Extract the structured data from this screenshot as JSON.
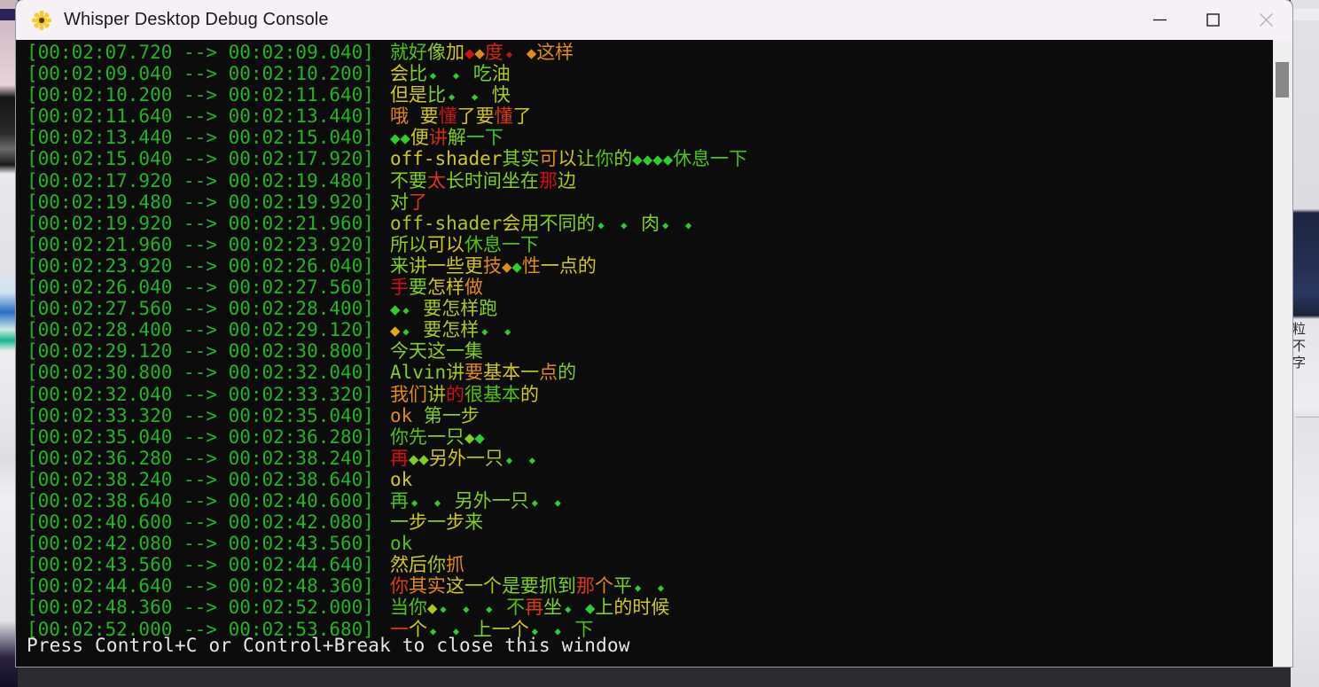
{
  "window": {
    "title": "Whisper Desktop Debug Console",
    "icon": "sunflower-icon",
    "controls": {
      "minimize": "minimize-icon",
      "maximize": "maximize-icon",
      "close": "close-icon"
    }
  },
  "colors": {
    "titlebar_bg": "#f6f1f6",
    "console_bg": "#0c0c0c",
    "timestamp_green": "#22b522",
    "status_text": "#e6e6e6",
    "scrollbar_track": "#efeff0",
    "scrollbar_thumb": "#878787",
    "conf_high": "#2ecc2e",
    "conf_good": "#7fcf1f",
    "conf_mid": "#cfc81a",
    "conf_low": "#e08a12",
    "conf_vlow": "#d83a12",
    "conf_worst": "#d01010"
  },
  "console": {
    "status": "Press Control+C or Control+Break to close this window",
    "lines": [
      {
        "start": "00:02:07.720",
        "end": "00:02:09.040",
        "segments": [
          {
            "t": "就好",
            "c": "#4fc20f"
          },
          {
            "t": "像",
            "c": "#8ecb12"
          },
          {
            "t": "加",
            "c": "#cfc81a"
          },
          {
            "t": "◆",
            "c": "#d01010",
            "glyph": "big"
          },
          {
            "t": "◆",
            "c": "#e08a12",
            "glyph": "big"
          },
          {
            "t": "度",
            "c": "#d02a0f"
          },
          {
            "t": "◆",
            "c": "#c01a0f",
            "glyph": "small"
          },
          {
            "t": " ",
            "c": "#000000"
          },
          {
            "t": "◆",
            "c": "#e08a12",
            "glyph": "big"
          },
          {
            "t": "这样",
            "c": "#e08a12"
          }
        ]
      },
      {
        "start": "00:02:09.040",
        "end": "00:02:10.200",
        "segments": [
          {
            "t": "会",
            "c": "#cfc81a"
          },
          {
            "t": "比",
            "c": "#7fcf1f"
          },
          {
            "t": "◆",
            "c": "#2ecc2e",
            "glyph": "small"
          },
          {
            "t": " ",
            "c": "#000000"
          },
          {
            "t": "◆",
            "c": "#2ecc2e",
            "glyph": "small"
          },
          {
            "t": " ",
            "c": "#000000"
          },
          {
            "t": "吃",
            "c": "#6fcc17"
          },
          {
            "t": "油",
            "c": "#a9c915"
          }
        ]
      },
      {
        "start": "00:02:10.200",
        "end": "00:02:11.640",
        "segments": [
          {
            "t": "但是",
            "c": "#cfc81a"
          },
          {
            "t": "比",
            "c": "#7fcf1f"
          },
          {
            "t": "◆",
            "c": "#2ecc2e",
            "glyph": "small"
          },
          {
            "t": " ",
            "c": "#000000"
          },
          {
            "t": "◆",
            "c": "#2ecc2e",
            "glyph": "small"
          },
          {
            "t": " ",
            "c": "#000000"
          },
          {
            "t": "快",
            "c": "#a9c915"
          }
        ]
      },
      {
        "start": "00:02:11.640",
        "end": "00:02:13.440",
        "segments": [
          {
            "t": "哦",
            "c": "#e08a12"
          },
          {
            "t": " ",
            "c": "#000000"
          },
          {
            "t": "要",
            "c": "#cfc81a"
          },
          {
            "t": "懂",
            "c": "#c01a0f"
          },
          {
            "t": "了",
            "c": "#cfc81a"
          },
          {
            "t": "要",
            "c": "#cfc81a"
          },
          {
            "t": "懂",
            "c": "#d83a12"
          },
          {
            "t": "了",
            "c": "#cfc81a"
          }
        ]
      },
      {
        "start": "00:02:13.440",
        "end": "00:02:15.040",
        "segments": [
          {
            "t": "◆",
            "c": "#2ecc2e",
            "glyph": "big"
          },
          {
            "t": "◆",
            "c": "#2ecc2e",
            "glyph": "big"
          },
          {
            "t": "便",
            "c": "#cfc81a"
          },
          {
            "t": "讲",
            "c": "#d02a0f"
          },
          {
            "t": "解",
            "c": "#7fcf1f"
          },
          {
            "t": "一下",
            "c": "#2ecc2e"
          }
        ]
      },
      {
        "start": "00:02:15.040",
        "end": "00:02:17.920",
        "segments": [
          {
            "t": "off-shader",
            "c": "#cfc81a"
          },
          {
            "t": "其实",
            "c": "#7fcf1f"
          },
          {
            "t": "可",
            "c": "#e08a12"
          },
          {
            "t": "以",
            "c": "#cfc81a"
          },
          {
            "t": "让",
            "c": "#8ecb12"
          },
          {
            "t": "你",
            "c": "#4fc20f"
          },
          {
            "t": "的",
            "c": "#7fcf1f"
          },
          {
            "t": "◆",
            "c": "#2ecc2e",
            "glyph": "big"
          },
          {
            "t": "◆",
            "c": "#2ecc2e",
            "glyph": "big"
          },
          {
            "t": "◆",
            "c": "#2ecc2e",
            "glyph": "big"
          },
          {
            "t": "◆",
            "c": "#2ecc2e",
            "glyph": "big"
          },
          {
            "t": "休息一下",
            "c": "#4fc20f"
          }
        ]
      },
      {
        "start": "00:02:17.920",
        "end": "00:02:19.480",
        "segments": [
          {
            "t": "不要",
            "c": "#7fcf1f"
          },
          {
            "t": "太",
            "c": "#d83a12"
          },
          {
            "t": "长时间坐在",
            "c": "#7fcf1f"
          },
          {
            "t": "那",
            "c": "#d01010"
          },
          {
            "t": "边",
            "c": "#a9c915"
          }
        ]
      },
      {
        "start": "00:02:19.480",
        "end": "00:02:19.920",
        "segments": [
          {
            "t": "对",
            "c": "#7fcf1f"
          },
          {
            "t": "了",
            "c": "#d83a12"
          }
        ]
      },
      {
        "start": "00:02:19.920",
        "end": "00:02:21.960",
        "segments": [
          {
            "t": "off-shader",
            "c": "#a9c915"
          },
          {
            "t": "会",
            "c": "#cfc81a"
          },
          {
            "t": "用",
            "c": "#8ecb12"
          },
          {
            "t": "不同的",
            "c": "#7fcf1f"
          },
          {
            "t": "◆",
            "c": "#2ecc2e",
            "glyph": "small"
          },
          {
            "t": " ",
            "c": "#000000"
          },
          {
            "t": "◆",
            "c": "#2ecc2e",
            "glyph": "small"
          },
          {
            "t": " ",
            "c": "#000000"
          },
          {
            "t": "肉",
            "c": "#7fcf1f"
          },
          {
            "t": "◆",
            "c": "#2ecc2e",
            "glyph": "small"
          },
          {
            "t": " ",
            "c": "#000000"
          },
          {
            "t": "◆",
            "c": "#2ecc2e",
            "glyph": "small"
          }
        ]
      },
      {
        "start": "00:02:21.960",
        "end": "00:02:23.920",
        "segments": [
          {
            "t": "所以",
            "c": "#8ecb12"
          },
          {
            "t": "可以",
            "c": "#cfc81a"
          },
          {
            "t": "休息一下",
            "c": "#4fc20f"
          }
        ]
      },
      {
        "start": "00:02:23.920",
        "end": "00:02:26.040",
        "segments": [
          {
            "t": "来",
            "c": "#7fcf1f"
          },
          {
            "t": "讲",
            "c": "#a9c915"
          },
          {
            "t": "一些",
            "c": "#cfc81a"
          },
          {
            "t": "更",
            "c": "#cfc81a"
          },
          {
            "t": "技",
            "c": "#e08a12"
          },
          {
            "t": "◆",
            "c": "#e08a12",
            "glyph": "big"
          },
          {
            "t": "◆",
            "c": "#2ecc2e",
            "glyph": "big"
          },
          {
            "t": "性",
            "c": "#e08a12"
          },
          {
            "t": "一点的",
            "c": "#cfc81a"
          }
        ]
      },
      {
        "start": "00:02:26.040",
        "end": "00:02:27.560",
        "segments": [
          {
            "t": "手",
            "c": "#d01010"
          },
          {
            "t": "要",
            "c": "#7fcf1f"
          },
          {
            "t": "怎样",
            "c": "#cfc81a"
          },
          {
            "t": "做",
            "c": "#e08a12"
          }
        ]
      },
      {
        "start": "00:02:27.560",
        "end": "00:02:28.400",
        "segments": [
          {
            "t": "◆",
            "c": "#2ecc2e",
            "glyph": "big"
          },
          {
            "t": "◆",
            "c": "#2ecc2e",
            "glyph": "small"
          },
          {
            "t": " ",
            "c": "#000000"
          },
          {
            "t": "要怎样",
            "c": "#a9c915"
          },
          {
            "t": "跑",
            "c": "#7fcf1f"
          }
        ]
      },
      {
        "start": "00:02:28.400",
        "end": "00:02:29.120",
        "segments": [
          {
            "t": "◆",
            "c": "#e0a812",
            "glyph": "big"
          },
          {
            "t": "◆",
            "c": "#2ecc2e",
            "glyph": "small"
          },
          {
            "t": " ",
            "c": "#000000"
          },
          {
            "t": "要怎样",
            "c": "#a9c915"
          },
          {
            "t": "◆",
            "c": "#2ecc2e",
            "glyph": "small"
          },
          {
            "t": " ",
            "c": "#000000"
          },
          {
            "t": "◆",
            "c": "#2ecc2e",
            "glyph": "small"
          }
        ]
      },
      {
        "start": "00:02:29.120",
        "end": "00:02:30.800",
        "segments": [
          {
            "t": "今天",
            "c": "#7fcf1f"
          },
          {
            "t": "这",
            "c": "#8ecb12"
          },
          {
            "t": "一集",
            "c": "#7fcf1f"
          }
        ]
      },
      {
        "start": "00:02:30.800",
        "end": "00:02:32.040",
        "segments": [
          {
            "t": "Alvin",
            "c": "#7fcf1f"
          },
          {
            "t": "讲",
            "c": "#a9c915"
          },
          {
            "t": "要",
            "c": "#e08a12"
          },
          {
            "t": "基本",
            "c": "#cfc81a"
          },
          {
            "t": "一",
            "c": "#a9c915"
          },
          {
            "t": "点",
            "c": "#e08a12"
          },
          {
            "t": "的",
            "c": "#7fcf1f"
          }
        ]
      },
      {
        "start": "00:02:32.040",
        "end": "00:02:33.320",
        "segments": [
          {
            "t": "我们",
            "c": "#e08a12"
          },
          {
            "t": "讲",
            "c": "#a9c915"
          },
          {
            "t": "的",
            "c": "#d01010"
          },
          {
            "t": "很",
            "c": "#4fc20f"
          },
          {
            "t": "基本",
            "c": "#4fc20f"
          },
          {
            "t": "的",
            "c": "#cfc81a"
          }
        ]
      },
      {
        "start": "00:02:33.320",
        "end": "00:02:35.040",
        "segments": [
          {
            "t": "ok",
            "c": "#e08a12"
          },
          {
            "t": " ",
            "c": "#000000"
          },
          {
            "t": "第一",
            "c": "#7fcf1f"
          },
          {
            "t": "步",
            "c": "#a9c915"
          }
        ]
      },
      {
        "start": "00:02:35.040",
        "end": "00:02:36.280",
        "segments": [
          {
            "t": "你先",
            "c": "#4fc20f"
          },
          {
            "t": "一只",
            "c": "#7fcf1f"
          },
          {
            "t": "◆",
            "c": "#7fcf1f",
            "glyph": "big"
          },
          {
            "t": "◆",
            "c": "#2ecc2e",
            "glyph": "big"
          }
        ]
      },
      {
        "start": "00:02:36.280",
        "end": "00:02:38.240",
        "segments": [
          {
            "t": "再",
            "c": "#d01010"
          },
          {
            "t": "◆",
            "c": "#7fcf1f",
            "glyph": "big"
          },
          {
            "t": "◆",
            "c": "#7fcf1f",
            "glyph": "big"
          },
          {
            "t": "另外",
            "c": "#cfc81a"
          },
          {
            "t": "一只",
            "c": "#a9c915"
          },
          {
            "t": "◆",
            "c": "#2ecc2e",
            "glyph": "small"
          },
          {
            "t": " ",
            "c": "#000000"
          },
          {
            "t": "◆",
            "c": "#2ecc2e",
            "glyph": "small"
          }
        ]
      },
      {
        "start": "00:02:38.240",
        "end": "00:02:38.640",
        "segments": [
          {
            "t": "ok",
            "c": "#cfc81a"
          }
        ]
      },
      {
        "start": "00:02:38.640",
        "end": "00:02:40.600",
        "segments": [
          {
            "t": "再",
            "c": "#4fc20f"
          },
          {
            "t": "◆",
            "c": "#2ecc2e",
            "glyph": "small"
          },
          {
            "t": " ",
            "c": "#000000"
          },
          {
            "t": "◆",
            "c": "#2ecc2e",
            "glyph": "small"
          },
          {
            "t": " ",
            "c": "#000000"
          },
          {
            "t": "另外一只",
            "c": "#7fcf1f"
          },
          {
            "t": "◆",
            "c": "#2ecc2e",
            "glyph": "small"
          },
          {
            "t": " ",
            "c": "#000000"
          },
          {
            "t": "◆",
            "c": "#2ecc2e",
            "glyph": "small"
          }
        ]
      },
      {
        "start": "00:02:40.600",
        "end": "00:02:42.080",
        "segments": [
          {
            "t": "一",
            "c": "#7fcf1f"
          },
          {
            "t": "步",
            "c": "#cfc81a"
          },
          {
            "t": "一",
            "c": "#7fcf1f"
          },
          {
            "t": "步",
            "c": "#cfc81a"
          },
          {
            "t": "来",
            "c": "#7fcf1f"
          }
        ]
      },
      {
        "start": "00:02:42.080",
        "end": "00:02:43.560",
        "segments": [
          {
            "t": "ok",
            "c": "#4fc20f"
          }
        ]
      },
      {
        "start": "00:02:43.560",
        "end": "00:02:44.640",
        "segments": [
          {
            "t": "然后",
            "c": "#cfc81a"
          },
          {
            "t": "你",
            "c": "#a9c915"
          },
          {
            "t": "抓",
            "c": "#e08a12"
          }
        ]
      },
      {
        "start": "00:02:44.640",
        "end": "00:02:48.360",
        "segments": [
          {
            "t": "你",
            "c": "#d83a12"
          },
          {
            "t": "其实",
            "c": "#e08a12"
          },
          {
            "t": "这",
            "c": "#cfc81a"
          },
          {
            "t": "一个",
            "c": "#a9c915"
          },
          {
            "t": "是要",
            "c": "#7fcf1f"
          },
          {
            "t": "抓到",
            "c": "#7fcf1f"
          },
          {
            "t": "那",
            "c": "#d83a12"
          },
          {
            "t": "个",
            "c": "#e08a12"
          },
          {
            "t": "平",
            "c": "#7fcf1f"
          },
          {
            "t": "◆",
            "c": "#2ecc2e",
            "glyph": "small"
          },
          {
            "t": " ",
            "c": "#000000"
          },
          {
            "t": "◆",
            "c": "#2ecc2e",
            "glyph": "small"
          }
        ]
      },
      {
        "start": "00:02:48.360",
        "end": "00:02:52.000",
        "segments": [
          {
            "t": "当你",
            "c": "#4fc20f"
          },
          {
            "t": "◆",
            "c": "#a9c915",
            "glyph": "big"
          },
          {
            "t": "◆",
            "c": "#2ecc2e",
            "glyph": "small"
          },
          {
            "t": " ",
            "c": "#000000"
          },
          {
            "t": "◆",
            "c": "#2ecc2e",
            "glyph": "small"
          },
          {
            "t": " ",
            "c": "#000000"
          },
          {
            "t": "◆",
            "c": "#2ecc2e",
            "glyph": "small"
          },
          {
            "t": " ",
            "c": "#000000"
          },
          {
            "t": "不",
            "c": "#4fc20f"
          },
          {
            "t": "再",
            "c": "#d83a12"
          },
          {
            "t": "坐",
            "c": "#7fcf1f"
          },
          {
            "t": "◆",
            "c": "#2ecc2e",
            "glyph": "small"
          },
          {
            "t": " ",
            "c": "#000000"
          },
          {
            "t": "◆",
            "c": "#2ecc2e",
            "glyph": "big"
          },
          {
            "t": "上",
            "c": "#7fcf1f"
          },
          {
            "t": "的时候",
            "c": "#cfc81a"
          }
        ]
      },
      {
        "start": "00:02:52.000",
        "end": "00:02:53.680",
        "segments": [
          {
            "t": "一",
            "c": "#d83a12"
          },
          {
            "t": "个",
            "c": "#cfc81a"
          },
          {
            "t": "◆",
            "c": "#2ecc2e",
            "glyph": "small"
          },
          {
            "t": " ",
            "c": "#000000"
          },
          {
            "t": "◆",
            "c": "#2ecc2e",
            "glyph": "small"
          },
          {
            "t": " ",
            "c": "#000000"
          },
          {
            "t": "上",
            "c": "#7fcf1f"
          },
          {
            "t": "一",
            "c": "#a9c915"
          },
          {
            "t": "个",
            "c": "#cfc81a"
          },
          {
            "t": "◆",
            "c": "#2ecc2e",
            "glyph": "small"
          },
          {
            "t": " ",
            "c": "#000000"
          },
          {
            "t": "◆",
            "c": "#2ecc2e",
            "glyph": "small"
          },
          {
            "t": " ",
            "c": "#000000"
          },
          {
            "t": "下",
            "c": "#4fc20f"
          }
        ]
      }
    ]
  },
  "background": {
    "right_panel_text": [
      "粒",
      "不",
      "字"
    ]
  }
}
